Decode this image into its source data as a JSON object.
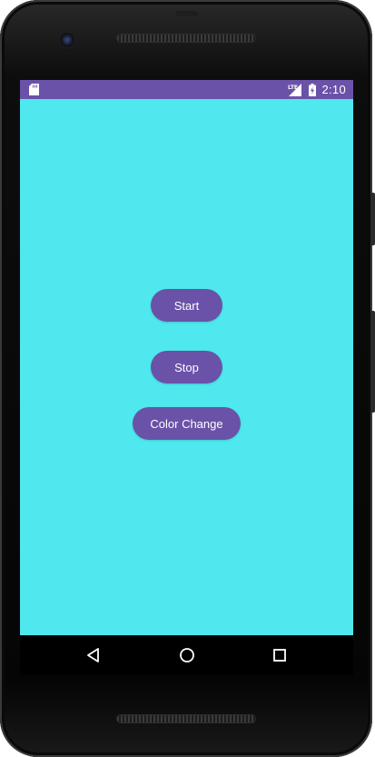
{
  "status_bar": {
    "time": "2:10",
    "background_color": "#6a52a8",
    "icons": [
      "sd-card-icon",
      "lte-signal-icon",
      "battery-charging-icon"
    ]
  },
  "screen": {
    "background_color": "#4ee8ee"
  },
  "buttons": {
    "start_label": "Start",
    "stop_label": "Stop",
    "color_change_label": "Color Change",
    "color": "#6a52a8"
  },
  "navigation_bar": {
    "icons": [
      "back-icon",
      "home-icon",
      "recents-icon"
    ]
  }
}
